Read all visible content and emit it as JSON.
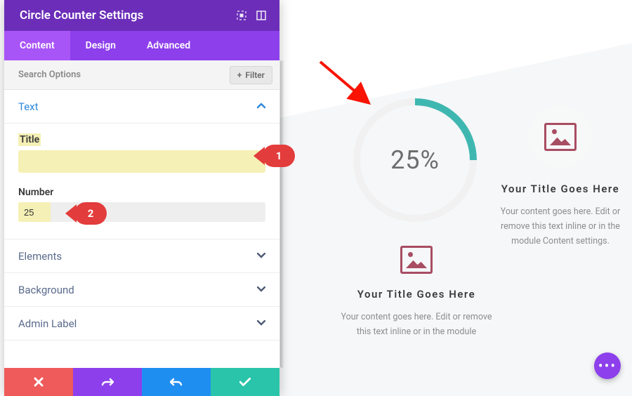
{
  "panel": {
    "title": "Circle Counter Settings",
    "tabs": [
      "Content",
      "Design",
      "Advanced"
    ],
    "active_tab": 0,
    "search_placeholder": "Search Options",
    "filter_label": "Filter",
    "sections": {
      "text": {
        "label": "Text",
        "open": true,
        "title_label": "Title",
        "title_value": "",
        "number_label": "Number",
        "number_value": "25"
      },
      "elements": {
        "label": "Elements",
        "open": false
      },
      "background": {
        "label": "Background",
        "open": false
      },
      "admin_label": {
        "label": "Admin Label",
        "open": false
      }
    }
  },
  "actions": {
    "cancel": "cancel",
    "undo": "undo",
    "redo": "redo",
    "save": "save"
  },
  "preview": {
    "circle_percent": 25,
    "circle_display": "25%",
    "blurb_title": "Your Title Goes Here",
    "blurb_body_full": "Your content goes here. Edit or remove this text inline or in the module Content settings.",
    "blurb_body_cut": "Your content goes here. Edit or remove this text inline or in the module"
  },
  "annotations": {
    "badge1": "1",
    "badge2": "2"
  },
  "fab_label": "•••",
  "colors": {
    "purple": "#8d3fec",
    "purple_dark": "#6c2eb9",
    "teal": "#3fb7b1",
    "red": "#ef5a5a",
    "blue": "#1f8ef1",
    "mint": "#29c4a9",
    "accent_red": "#e33c3c",
    "icon_maroon": "#a84d62"
  }
}
